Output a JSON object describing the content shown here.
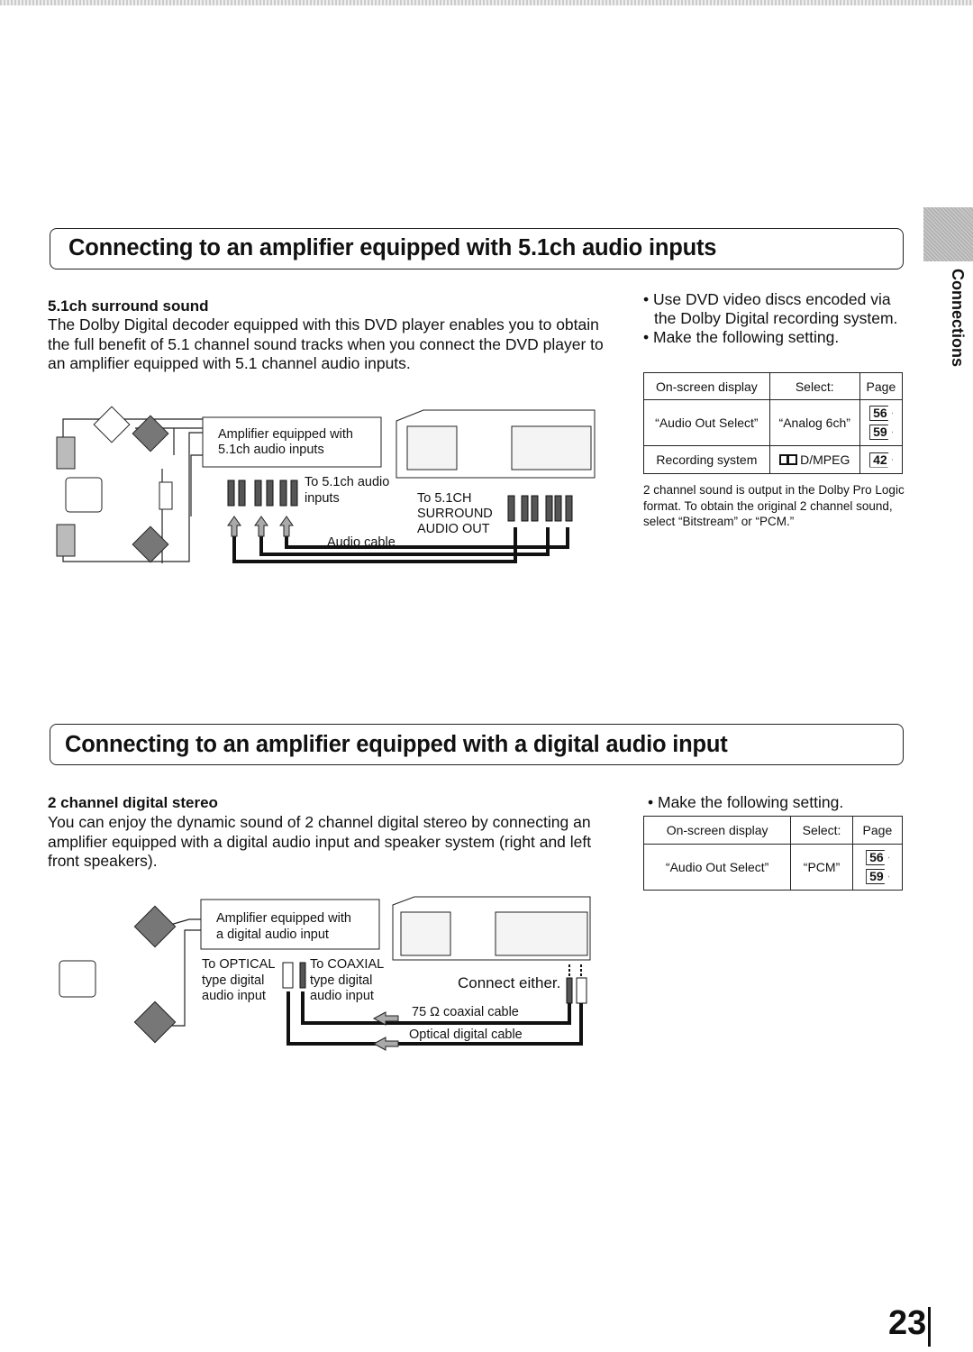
{
  "side_tab": {
    "label": "Connections"
  },
  "section1": {
    "title": "Connecting to an amplifier equipped with 5.1ch audio inputs",
    "subheading": "5.1ch surround sound",
    "body": "The Dolby Digital decoder equipped with this DVD player enables you to obtain the full benefit of 5.1 channel sound tracks when you connect the DVD player to an amplifier equipped with 5.1 channel audio inputs.",
    "bullets": [
      "Use DVD video discs encoded via the Dolby Digital recording system.",
      "Make the following setting."
    ],
    "table": {
      "headers": [
        "On-screen display",
        "Select:",
        "Page"
      ],
      "rows": [
        {
          "display": "“Audio Out Select”",
          "select": "“Analog 6ch”",
          "pages": [
            "56",
            "59"
          ]
        },
        {
          "display": "Recording system",
          "select": "D/MPEG",
          "pages": [
            "42"
          ]
        }
      ]
    },
    "note": "2 channel sound is output in the Dolby Pro Logic format. To obtain the original 2 channel sound, select “Bitstream” or “PCM.”",
    "diagram": {
      "amp_label_1": "Amplifier equipped with",
      "amp_label_2": "5.1ch audio inputs",
      "inputs_label_1": "To 5.1ch audio",
      "inputs_label_2": "inputs",
      "out_label_1": "To 5.1CH",
      "out_label_2": "SURROUND",
      "out_label_3": "AUDIO OUT",
      "cable_label": "Audio cable"
    }
  },
  "section2": {
    "title": "Connecting to an amplifier equipped with a digital audio input",
    "subheading": "2 channel digital stereo",
    "body": "You can enjoy the dynamic sound of 2 channel digital stereo by connecting an amplifier equipped with a digital audio input and speaker system (right and left front speakers).",
    "bullets": [
      "Make the following setting."
    ],
    "table": {
      "headers": [
        "On-screen display",
        "Select:",
        "Page"
      ],
      "rows": [
        {
          "display": "“Audio Out Select”",
          "select": "“PCM”",
          "pages": [
            "56",
            "59"
          ]
        }
      ]
    },
    "diagram": {
      "amp_label_1": "Amplifier equipped with",
      "amp_label_2": "a digital audio input",
      "optical_1": "To OPTICAL",
      "optical_2": "type digital",
      "optical_3": "audio input",
      "coaxial_1": "To COAXIAL",
      "coaxial_2": "type digital",
      "coaxial_3": "audio input",
      "connect_either": "Connect either.",
      "coax_cable": "75 Ω coaxial cable",
      "optical_cable": "Optical digital cable"
    }
  },
  "page_number": "23"
}
